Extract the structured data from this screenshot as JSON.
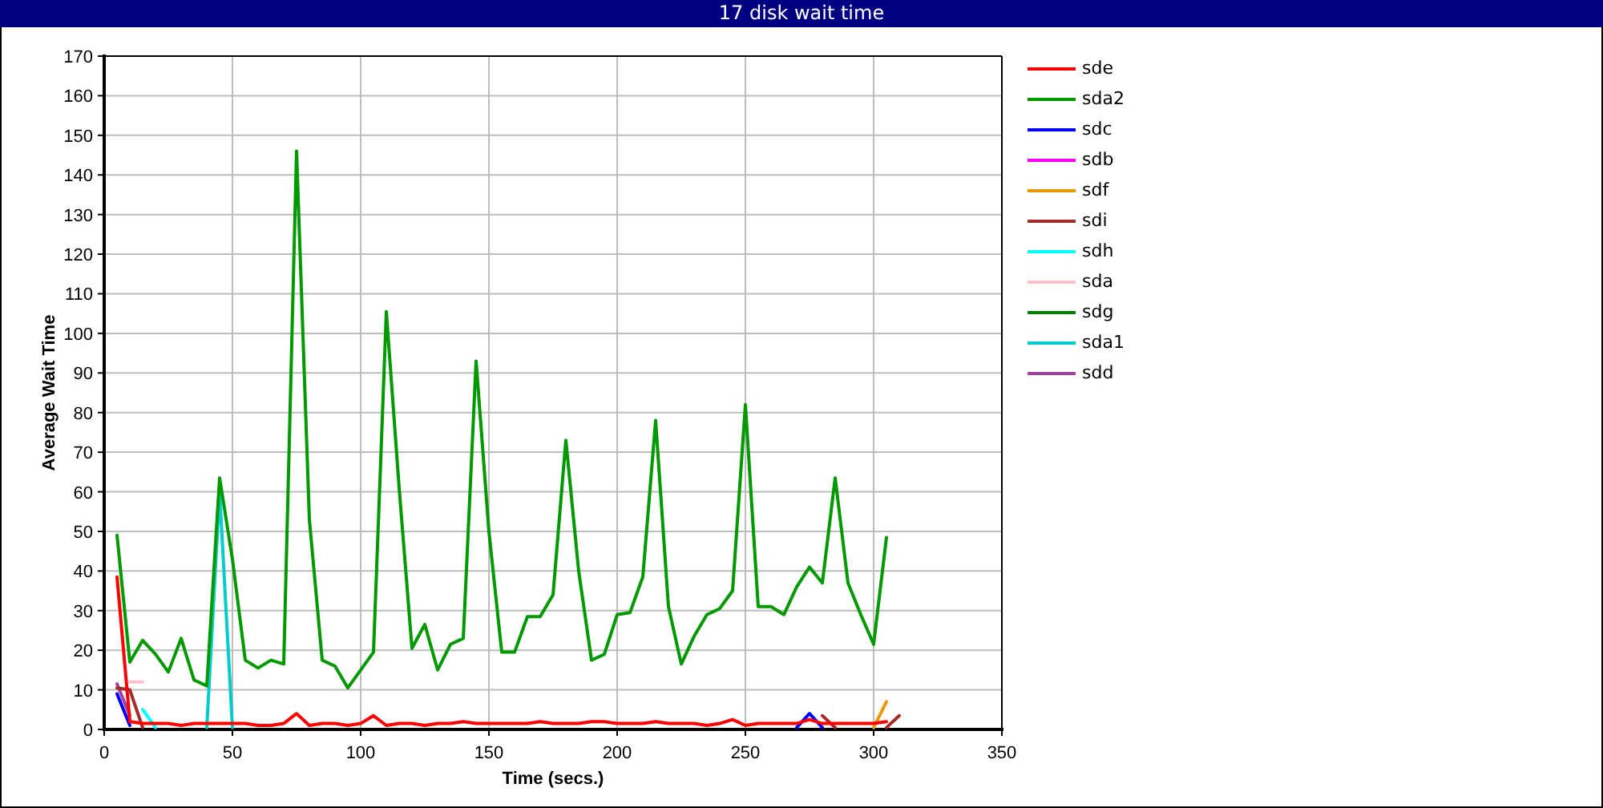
{
  "window": {
    "title": "17 disk wait time"
  },
  "chart_data": {
    "type": "line",
    "grid": true,
    "xlabel": "Time (secs.)",
    "ylabel": "Average Wait Time",
    "xlim": [
      0,
      350
    ],
    "ylim": [
      0,
      170
    ],
    "xticks": [
      0,
      50,
      100,
      150,
      200,
      250,
      300,
      350
    ],
    "yticks": [
      0,
      10,
      20,
      30,
      40,
      50,
      60,
      70,
      80,
      90,
      100,
      110,
      120,
      130,
      140,
      150,
      160,
      170
    ],
    "x": [
      5,
      10,
      15,
      20,
      25,
      30,
      35,
      40,
      45,
      50,
      55,
      60,
      65,
      70,
      75,
      80,
      85,
      90,
      95,
      100,
      105,
      110,
      115,
      120,
      125,
      130,
      135,
      140,
      145,
      150,
      155,
      160,
      165,
      170,
      175,
      180,
      185,
      190,
      195,
      200,
      205,
      210,
      215,
      220,
      225,
      230,
      235,
      240,
      245,
      250,
      255,
      260,
      265,
      270,
      275,
      280,
      285,
      290,
      295,
      300,
      305,
      310
    ],
    "series": [
      {
        "name": "sde",
        "color": "#ff0000",
        "values": [
          38.5,
          2,
          1.5,
          1.5,
          1.5,
          1,
          1.5,
          1.5,
          1.5,
          1.5,
          1.5,
          1,
          1,
          1.5,
          4,
          1,
          1.5,
          1.5,
          1,
          1.5,
          3.5,
          1,
          1.5,
          1.5,
          1,
          1.5,
          1.5,
          2,
          1.5,
          1.5,
          1.5,
          1.5,
          1.5,
          2,
          1.5,
          1.5,
          1.5,
          2,
          2,
          1.5,
          1.5,
          1.5,
          2,
          1.5,
          1.5,
          1.5,
          1,
          1.5,
          2.5,
          1,
          1.5,
          1.5,
          1.5,
          1.5,
          2.5,
          1.5,
          1.5,
          1.5,
          1.5,
          1.5,
          2,
          null
        ]
      },
      {
        "name": "sda2",
        "color": "#009900",
        "values": [
          49,
          17,
          22.5,
          19,
          14.5,
          23,
          12.5,
          11,
          63.5,
          43,
          17.5,
          15.5,
          17.5,
          16.5,
          146,
          53,
          17.5,
          16,
          10.5,
          15,
          19.5,
          105.5,
          61,
          20.5,
          26.5,
          15,
          21.5,
          23,
          93,
          50,
          19.5,
          19.5,
          28.5,
          28.5,
          34,
          73,
          40,
          17.5,
          19,
          29,
          29.5,
          38.5,
          78,
          31,
          16.5,
          23.5,
          29,
          30.5,
          35,
          82,
          31,
          31,
          29,
          36,
          41,
          37,
          63.5,
          37,
          29,
          21.5,
          48.5,
          null
        ]
      },
      {
        "name": "sdc",
        "color": "#0000ff",
        "values": [
          9,
          1,
          null,
          null,
          null,
          null,
          null,
          null,
          null,
          null,
          null,
          null,
          null,
          null,
          null,
          null,
          null,
          null,
          null,
          null,
          null,
          null,
          null,
          null,
          null,
          null,
          null,
          null,
          null,
          null,
          null,
          null,
          null,
          null,
          null,
          null,
          null,
          null,
          null,
          null,
          null,
          null,
          null,
          null,
          null,
          null,
          null,
          null,
          null,
          null,
          null,
          null,
          null,
          0.5,
          4,
          0.5,
          null,
          null,
          null,
          null,
          null,
          null
        ]
      },
      {
        "name": "sdb",
        "color": "#ff00ff",
        "values": [
          null,
          null,
          null,
          null,
          null,
          null,
          null,
          null,
          null,
          null,
          null,
          null,
          null,
          null,
          null,
          null,
          null,
          null,
          null,
          null,
          null,
          null,
          null,
          null,
          null,
          null,
          null,
          null,
          null,
          null,
          null,
          null,
          null,
          null,
          null,
          null,
          null,
          null,
          null,
          null,
          null,
          null,
          null,
          null,
          null,
          null,
          null,
          null,
          null,
          null,
          null,
          null,
          null,
          null,
          null,
          null,
          null,
          null,
          null,
          null,
          null,
          null
        ]
      },
      {
        "name": "sdf",
        "color": "#e69900",
        "values": [
          null,
          null,
          null,
          null,
          null,
          null,
          null,
          null,
          null,
          null,
          null,
          null,
          null,
          null,
          null,
          null,
          null,
          null,
          null,
          null,
          null,
          null,
          null,
          null,
          null,
          null,
          null,
          null,
          null,
          null,
          null,
          null,
          null,
          null,
          null,
          null,
          null,
          null,
          null,
          null,
          null,
          null,
          null,
          null,
          null,
          null,
          null,
          null,
          null,
          null,
          null,
          null,
          null,
          null,
          null,
          null,
          null,
          null,
          null,
          0.5,
          7,
          null
        ]
      },
      {
        "name": "sdi",
        "color": "#a52a2a",
        "values": [
          10.5,
          10,
          0.5,
          null,
          null,
          null,
          null,
          null,
          null,
          null,
          null,
          null,
          null,
          null,
          null,
          null,
          null,
          null,
          null,
          null,
          null,
          null,
          null,
          null,
          null,
          null,
          null,
          null,
          null,
          null,
          null,
          null,
          null,
          null,
          null,
          null,
          null,
          null,
          null,
          null,
          null,
          null,
          null,
          null,
          null,
          null,
          null,
          null,
          null,
          null,
          null,
          null,
          null,
          null,
          null,
          3.5,
          0.5,
          null,
          null,
          null,
          0.5,
          3.5
        ]
      },
      {
        "name": "sdh",
        "color": "#00ffff",
        "values": [
          null,
          null,
          5,
          0.5,
          null,
          null,
          null,
          null,
          null,
          null,
          null,
          null,
          null,
          null,
          null,
          null,
          null,
          null,
          null,
          null,
          null,
          null,
          null,
          null,
          null,
          null,
          null,
          null,
          null,
          null,
          null,
          null,
          null,
          null,
          null,
          null,
          null,
          null,
          null,
          null,
          null,
          null,
          null,
          null,
          null,
          null,
          null,
          null,
          null,
          null,
          null,
          null,
          null,
          null,
          null,
          null,
          null,
          null,
          null,
          null,
          null,
          null
        ]
      },
      {
        "name": "sda",
        "color": "#ffc0cb",
        "values": [
          null,
          12,
          12,
          null,
          null,
          null,
          null,
          null,
          null,
          null,
          null,
          null,
          null,
          null,
          null,
          null,
          null,
          null,
          null,
          null,
          null,
          null,
          null,
          null,
          null,
          null,
          null,
          null,
          null,
          null,
          null,
          null,
          null,
          null,
          null,
          null,
          null,
          null,
          null,
          null,
          null,
          null,
          null,
          null,
          null,
          null,
          null,
          null,
          null,
          null,
          null,
          null,
          null,
          null,
          null,
          null,
          null,
          null,
          null,
          null,
          null,
          null
        ]
      },
      {
        "name": "sdg",
        "color": "#007f00",
        "values": [
          null,
          null,
          null,
          null,
          null,
          null,
          null,
          null,
          null,
          null,
          null,
          null,
          null,
          null,
          null,
          null,
          null,
          null,
          null,
          null,
          null,
          null,
          null,
          null,
          null,
          null,
          null,
          null,
          null,
          null,
          null,
          null,
          null,
          null,
          null,
          null,
          null,
          null,
          null,
          null,
          null,
          null,
          null,
          null,
          null,
          null,
          null,
          null,
          null,
          null,
          null,
          null,
          null,
          null,
          null,
          null,
          null,
          null,
          null,
          null,
          null,
          null
        ]
      },
      {
        "name": "sda1",
        "color": "#00cccc",
        "values": [
          null,
          null,
          null,
          null,
          null,
          null,
          null,
          0.5,
          60,
          0.5,
          null,
          null,
          null,
          null,
          null,
          null,
          null,
          null,
          null,
          null,
          null,
          null,
          null,
          null,
          null,
          null,
          null,
          null,
          null,
          null,
          null,
          null,
          null,
          null,
          null,
          null,
          null,
          null,
          null,
          null,
          null,
          null,
          null,
          null,
          null,
          null,
          null,
          null,
          null,
          null,
          null,
          null,
          null,
          null,
          null,
          null,
          null,
          null,
          null,
          null,
          null,
          null
        ]
      },
      {
        "name": "sdd",
        "color": "#a040a0",
        "values": [
          11.5,
          3.5,
          null,
          null,
          null,
          null,
          null,
          null,
          null,
          null,
          null,
          null,
          null,
          null,
          null,
          null,
          null,
          null,
          null,
          null,
          null,
          null,
          null,
          null,
          null,
          null,
          null,
          null,
          null,
          null,
          null,
          null,
          null,
          null,
          null,
          null,
          null,
          null,
          null,
          null,
          null,
          null,
          null,
          null,
          null,
          null,
          null,
          null,
          null,
          null,
          null,
          null,
          null,
          null,
          null,
          null,
          null,
          null,
          null,
          null,
          null,
          null
        ]
      }
    ]
  }
}
